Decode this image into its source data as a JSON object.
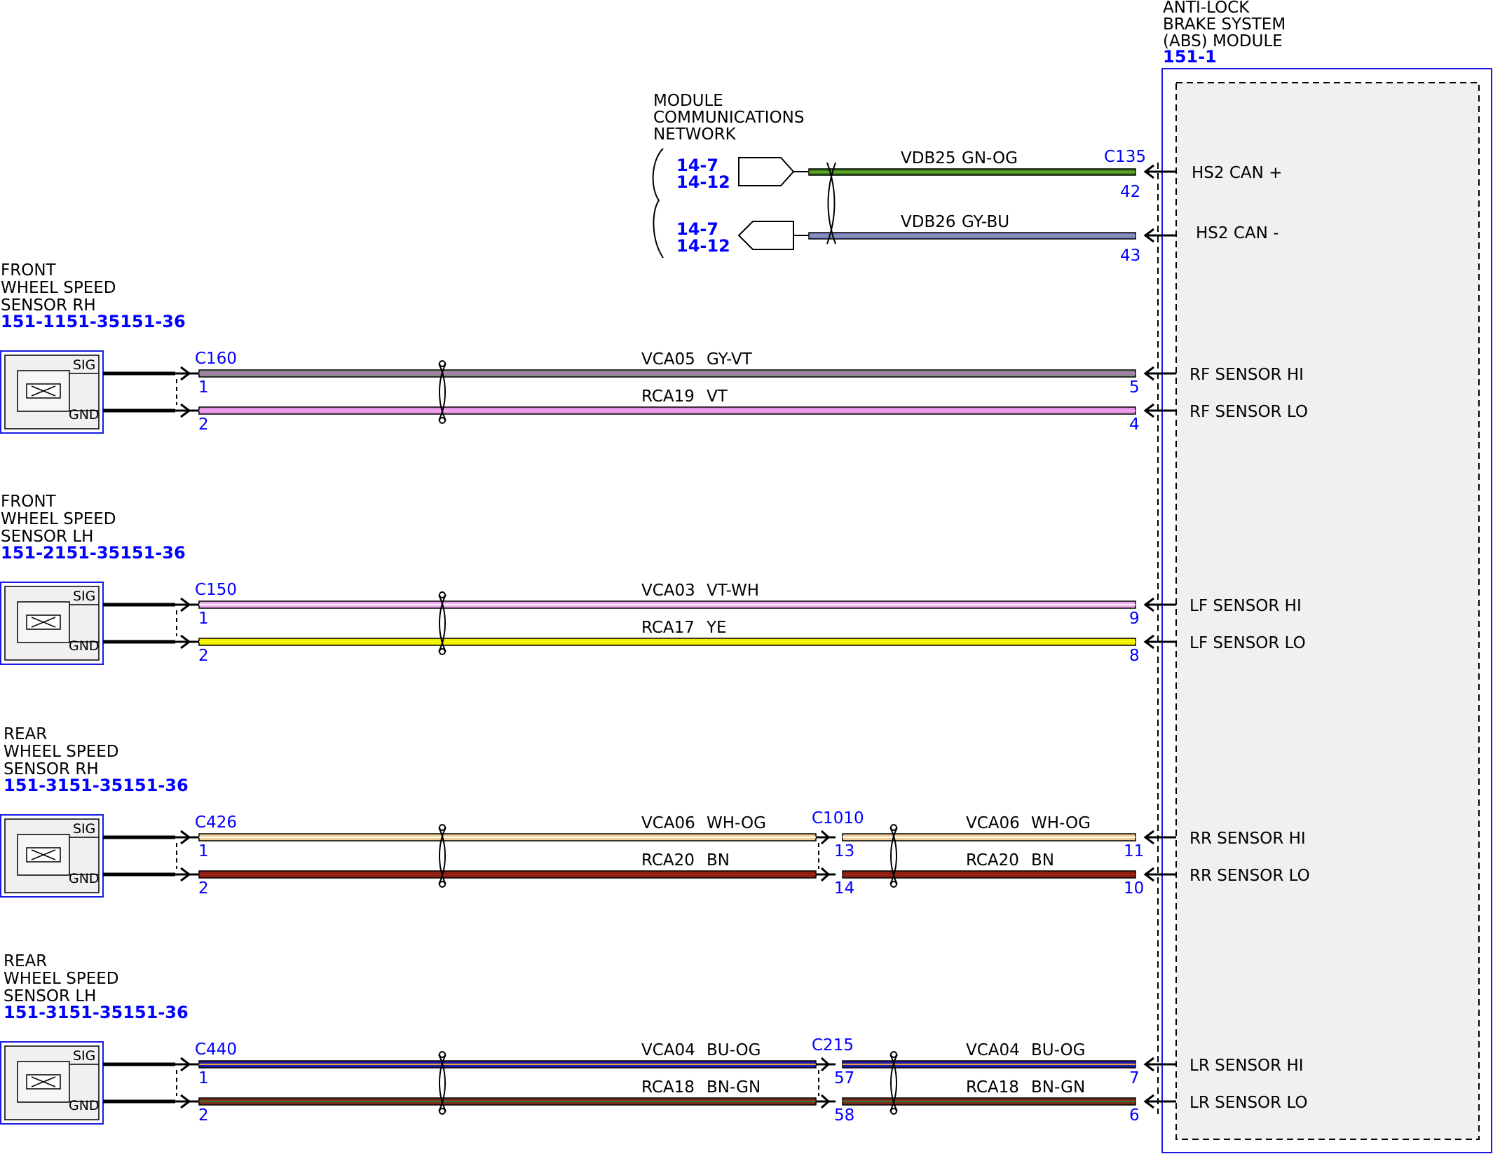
{
  "colors": {
    "link_blue": "#0000ff",
    "module_fill": "#f0f0f0",
    "GN-OG": "#3a7d16",
    "GY-BU": "#7b86c8",
    "GY-VT": "#8c8c8c",
    "VT": "#e690e6",
    "VT-WH": "#f0a8f0",
    "YE": "#f0f000",
    "WH-OG": "#f2cf92",
    "BN": "#8c1e14",
    "BU-OG": "#1c1ca8",
    "BN-GN": "#7a2e1e"
  },
  "abs_module": {
    "title_lines": [
      "ANTI-LOCK",
      "BRAKE SYSTEM",
      "(ABS) MODULE"
    ],
    "ref": "151-1"
  },
  "network": {
    "title_lines": [
      "MODULE",
      "COMMUNICATIONS",
      "NETWORK"
    ],
    "refs_a": [
      "14-7",
      "14-12"
    ],
    "refs_b": [
      "14-7",
      "14-12"
    ]
  },
  "can_wires": [
    {
      "circuit": "VDB25",
      "color": "GN-OG",
      "connector": "C135",
      "pin": "42",
      "pin_name": "HS2 CAN +"
    },
    {
      "circuit": "VDB26",
      "color": "GY-BU",
      "connector": "",
      "pin": "43",
      "pin_name": "HS2 CAN -"
    }
  ],
  "sensors": [
    {
      "title_lines": [
        "FRONT",
        "WHEEL SPEED",
        "SENSOR RH"
      ],
      "refs": [
        "151-1",
        "151-35",
        "151-36"
      ],
      "sig": "SIG",
      "gnd": "GND",
      "connector": "C160",
      "inline_connector": "",
      "wires": [
        {
          "circuit": "VCA05",
          "color": "GY-VT",
          "sensor_pin": "1",
          "inline_pins": [],
          "module_pin": "5",
          "pin_name": "RF SENSOR HI"
        },
        {
          "circuit": "RCA19",
          "color": "VT",
          "sensor_pin": "2",
          "inline_pins": [],
          "module_pin": "4",
          "pin_name": "RF SENSOR LO"
        }
      ]
    },
    {
      "title_lines": [
        "FRONT",
        "WHEEL SPEED",
        "SENSOR LH"
      ],
      "refs": [
        "151-2",
        "151-35",
        "151-36"
      ],
      "sig": "SIG",
      "gnd": "GND",
      "connector": "C150",
      "inline_connector": "",
      "wires": [
        {
          "circuit": "VCA03",
          "color": "VT-WH",
          "sensor_pin": "1",
          "inline_pins": [],
          "module_pin": "9",
          "pin_name": "LF SENSOR HI"
        },
        {
          "circuit": "RCA17",
          "color": "YE",
          "sensor_pin": "2",
          "inline_pins": [],
          "module_pin": "8",
          "pin_name": "LF SENSOR LO"
        }
      ]
    },
    {
      "title_lines": [
        "REAR",
        "WHEEL SPEED",
        "SENSOR RH"
      ],
      "refs": [
        "151-3",
        "151-35",
        "151-36"
      ],
      "sig": "SIG",
      "gnd": "GND",
      "connector": "C426",
      "inline_connector": "C1010",
      "wires": [
        {
          "circuit": "VCA06",
          "color": "WH-OG",
          "sensor_pin": "1",
          "inline_pins": [
            "13"
          ],
          "module_pin": "11",
          "pin_name": "RR SENSOR HI"
        },
        {
          "circuit": "RCA20",
          "color": "BN",
          "sensor_pin": "2",
          "inline_pins": [
            "14"
          ],
          "module_pin": "10",
          "pin_name": "RR SENSOR LO"
        }
      ]
    },
    {
      "title_lines": [
        "REAR",
        "WHEEL SPEED",
        "SENSOR LH"
      ],
      "refs": [
        "151-3",
        "151-35",
        "151-36"
      ],
      "sig": "SIG",
      "gnd": "GND",
      "connector": "C440",
      "inline_connector": "C215",
      "wires": [
        {
          "circuit": "VCA04",
          "color": "BU-OG",
          "sensor_pin": "1",
          "inline_pins": [
            "57"
          ],
          "module_pin": "7",
          "pin_name": "LR SENSOR HI"
        },
        {
          "circuit": "RCA18",
          "color": "BN-GN",
          "sensor_pin": "2",
          "inline_pins": [
            "58"
          ],
          "module_pin": "6",
          "pin_name": "LR SENSOR LO"
        }
      ]
    }
  ]
}
